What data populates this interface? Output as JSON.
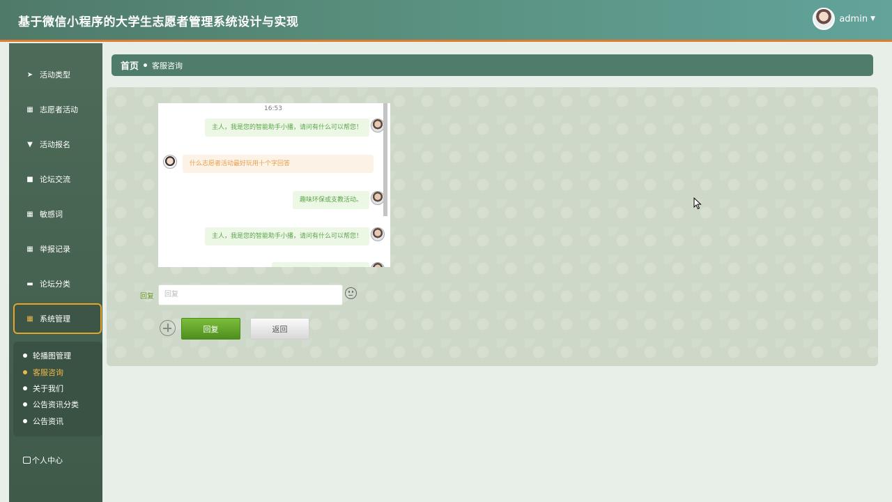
{
  "header": {
    "title": "基于微信小程序的大学生志愿者管理系统设计与实现",
    "username": "admin"
  },
  "sidebar": {
    "items": [
      {
        "label": "活动类型",
        "icon": "send-icon"
      },
      {
        "label": "志愿者活动",
        "icon": "grid-icon"
      },
      {
        "label": "活动报名",
        "icon": "pin-icon"
      },
      {
        "label": "论坛交流",
        "icon": "briefcase-icon"
      },
      {
        "label": "敏感词",
        "icon": "grid-icon"
      },
      {
        "label": "举报记录",
        "icon": "grid-icon"
      },
      {
        "label": "论坛分类",
        "icon": "comment-icon"
      },
      {
        "label": "系统管理",
        "icon": "grid-icon"
      }
    ],
    "submenu": [
      "轮播图管理",
      "客服咨询",
      "关于我们",
      "公告资讯分类",
      "公告资讯"
    ],
    "personal_center": "个人中心"
  },
  "breadcrumb": {
    "home": "首页",
    "current": "客服咨询"
  },
  "chat": {
    "time": "16:53",
    "messages": [
      {
        "from": "bot",
        "text": "主人，我是您的智能助手小播，请问有什么可以帮您！"
      },
      {
        "from": "user",
        "text": "什么志愿者活动最好玩用十个字回答"
      },
      {
        "from": "bot",
        "text": "趣味环保或支教活动。"
      },
      {
        "from": "bot",
        "text": "主人，我是您的智能助手小播，请问有什么可以帮您！"
      }
    ]
  },
  "reply": {
    "label": "回复",
    "placeholder": "回复",
    "submit_label": "回复",
    "back_label": "返回"
  },
  "colors": {
    "accent": "#e07c2c",
    "primary_green": "#5aa64a",
    "sidebar": "#4d6b58"
  }
}
